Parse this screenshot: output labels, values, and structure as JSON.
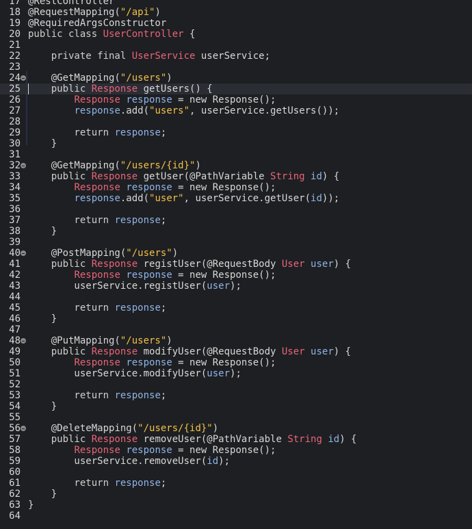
{
  "editor": {
    "language": "java",
    "current_line": 25,
    "colors": {
      "background": "#1e1f22",
      "current_line": "#2a2d34",
      "keyword": "#cfcfcf",
      "class": "#e8657a",
      "string": "#f0c14b",
      "variable": "#8fb4ea",
      "plain": "#d8d8d8",
      "fold_icon": "#8a8a8a"
    },
    "lines": [
      {
        "num": "17",
        "fold": false,
        "tokens": [
          {
            "t": "@RestController",
            "c": "ann"
          }
        ]
      },
      {
        "num": "18",
        "fold": false,
        "tokens": [
          {
            "t": "@RequestMapping(",
            "c": "ann"
          },
          {
            "t": "\"/api\"",
            "c": "str"
          },
          {
            "t": ")",
            "c": "plain"
          }
        ]
      },
      {
        "num": "19",
        "fold": false,
        "tokens": [
          {
            "t": "@RequiredArgsConstructor",
            "c": "ann"
          }
        ]
      },
      {
        "num": "20",
        "fold": false,
        "tokens": [
          {
            "t": "public class ",
            "c": "kw"
          },
          {
            "t": "UserController",
            "c": "cls"
          },
          {
            "t": " {",
            "c": "plain"
          }
        ]
      },
      {
        "num": "21",
        "fold": false,
        "tokens": []
      },
      {
        "num": "22",
        "fold": false,
        "tokens": [
          {
            "t": "    private final ",
            "c": "kw"
          },
          {
            "t": "UserService",
            "c": "cls"
          },
          {
            "t": " userService;",
            "c": "plain"
          }
        ]
      },
      {
        "num": "23",
        "fold": false,
        "tokens": []
      },
      {
        "num": "24",
        "fold": true,
        "tokens": [
          {
            "t": "    @GetMapping(",
            "c": "ann"
          },
          {
            "t": "\"/users\"",
            "c": "str"
          },
          {
            "t": ")",
            "c": "plain"
          }
        ]
      },
      {
        "num": "25",
        "fold": false,
        "tokens": [
          {
            "t": "    public ",
            "c": "kw"
          },
          {
            "t": "Response",
            "c": "cls"
          },
          {
            "t": " getUsers() {",
            "c": "plain"
          }
        ]
      },
      {
        "num": "26",
        "fold": false,
        "tokens": [
          {
            "t": "        ",
            "c": "plain"
          },
          {
            "t": "Response",
            "c": "cls"
          },
          {
            "t": " ",
            "c": "plain"
          },
          {
            "t": "response",
            "c": "var"
          },
          {
            "t": " = new Response();",
            "c": "plain"
          }
        ]
      },
      {
        "num": "27",
        "fold": false,
        "tokens": [
          {
            "t": "        ",
            "c": "plain"
          },
          {
            "t": "response",
            "c": "var"
          },
          {
            "t": ".add(",
            "c": "plain"
          },
          {
            "t": "\"users\"",
            "c": "str"
          },
          {
            "t": ", userService.getUsers());",
            "c": "plain"
          }
        ]
      },
      {
        "num": "28",
        "fold": false,
        "tokens": []
      },
      {
        "num": "29",
        "fold": false,
        "tokens": [
          {
            "t": "        return ",
            "c": "kw"
          },
          {
            "t": "response",
            "c": "var"
          },
          {
            "t": ";",
            "c": "plain"
          }
        ]
      },
      {
        "num": "30",
        "fold": false,
        "tokens": [
          {
            "t": "    }",
            "c": "plain"
          }
        ]
      },
      {
        "num": "31",
        "fold": false,
        "tokens": []
      },
      {
        "num": "32",
        "fold": true,
        "tokens": [
          {
            "t": "    @GetMapping(",
            "c": "ann"
          },
          {
            "t": "\"/users/{id}\"",
            "c": "str"
          },
          {
            "t": ")",
            "c": "plain"
          }
        ]
      },
      {
        "num": "33",
        "fold": false,
        "tokens": [
          {
            "t": "    public ",
            "c": "kw"
          },
          {
            "t": "Response",
            "c": "cls"
          },
          {
            "t": " getUser(@PathVariable ",
            "c": "plain"
          },
          {
            "t": "String",
            "c": "cls"
          },
          {
            "t": " ",
            "c": "plain"
          },
          {
            "t": "id",
            "c": "var"
          },
          {
            "t": ") {",
            "c": "plain"
          }
        ]
      },
      {
        "num": "34",
        "fold": false,
        "tokens": [
          {
            "t": "        ",
            "c": "plain"
          },
          {
            "t": "Response",
            "c": "cls"
          },
          {
            "t": " ",
            "c": "plain"
          },
          {
            "t": "response",
            "c": "var"
          },
          {
            "t": " = new Response();",
            "c": "plain"
          }
        ]
      },
      {
        "num": "35",
        "fold": false,
        "tokens": [
          {
            "t": "        ",
            "c": "plain"
          },
          {
            "t": "response",
            "c": "var"
          },
          {
            "t": ".add(",
            "c": "plain"
          },
          {
            "t": "\"user\"",
            "c": "str"
          },
          {
            "t": ", userService.getUser(",
            "c": "plain"
          },
          {
            "t": "id",
            "c": "var"
          },
          {
            "t": "));",
            "c": "plain"
          }
        ]
      },
      {
        "num": "36",
        "fold": false,
        "tokens": []
      },
      {
        "num": "37",
        "fold": false,
        "tokens": [
          {
            "t": "        return ",
            "c": "kw"
          },
          {
            "t": "response",
            "c": "var"
          },
          {
            "t": ";",
            "c": "plain"
          }
        ]
      },
      {
        "num": "38",
        "fold": false,
        "tokens": [
          {
            "t": "    }",
            "c": "plain"
          }
        ]
      },
      {
        "num": "39",
        "fold": false,
        "tokens": []
      },
      {
        "num": "40",
        "fold": true,
        "tokens": [
          {
            "t": "    @PostMapping(",
            "c": "ann"
          },
          {
            "t": "\"/users\"",
            "c": "str"
          },
          {
            "t": ")",
            "c": "plain"
          }
        ]
      },
      {
        "num": "41",
        "fold": false,
        "tokens": [
          {
            "t": "    public ",
            "c": "kw"
          },
          {
            "t": "Response",
            "c": "cls"
          },
          {
            "t": " registUser(@RequestBody ",
            "c": "plain"
          },
          {
            "t": "User",
            "c": "cls"
          },
          {
            "t": " ",
            "c": "plain"
          },
          {
            "t": "user",
            "c": "var"
          },
          {
            "t": ") {",
            "c": "plain"
          }
        ]
      },
      {
        "num": "42",
        "fold": false,
        "tokens": [
          {
            "t": "        ",
            "c": "plain"
          },
          {
            "t": "Response",
            "c": "cls"
          },
          {
            "t": " ",
            "c": "plain"
          },
          {
            "t": "response",
            "c": "var"
          },
          {
            "t": " = new Response();",
            "c": "plain"
          }
        ]
      },
      {
        "num": "43",
        "fold": false,
        "tokens": [
          {
            "t": "        userService.registUser(",
            "c": "plain"
          },
          {
            "t": "user",
            "c": "var"
          },
          {
            "t": ");",
            "c": "plain"
          }
        ]
      },
      {
        "num": "44",
        "fold": false,
        "tokens": []
      },
      {
        "num": "45",
        "fold": false,
        "tokens": [
          {
            "t": "        return ",
            "c": "kw"
          },
          {
            "t": "response",
            "c": "var"
          },
          {
            "t": ";",
            "c": "plain"
          }
        ]
      },
      {
        "num": "46",
        "fold": false,
        "tokens": [
          {
            "t": "    }",
            "c": "plain"
          }
        ]
      },
      {
        "num": "47",
        "fold": false,
        "tokens": []
      },
      {
        "num": "48",
        "fold": true,
        "tokens": [
          {
            "t": "    @PutMapping(",
            "c": "ann"
          },
          {
            "t": "\"/users\"",
            "c": "str"
          },
          {
            "t": ")",
            "c": "plain"
          }
        ]
      },
      {
        "num": "49",
        "fold": false,
        "tokens": [
          {
            "t": "    public ",
            "c": "kw"
          },
          {
            "t": "Response",
            "c": "cls"
          },
          {
            "t": " modifyUser(@RequestBody ",
            "c": "plain"
          },
          {
            "t": "User",
            "c": "cls"
          },
          {
            "t": " ",
            "c": "plain"
          },
          {
            "t": "user",
            "c": "var"
          },
          {
            "t": ") {",
            "c": "plain"
          }
        ]
      },
      {
        "num": "50",
        "fold": false,
        "tokens": [
          {
            "t": "        ",
            "c": "plain"
          },
          {
            "t": "Response",
            "c": "cls"
          },
          {
            "t": " ",
            "c": "plain"
          },
          {
            "t": "response",
            "c": "var"
          },
          {
            "t": " = new Response();",
            "c": "plain"
          }
        ]
      },
      {
        "num": "51",
        "fold": false,
        "tokens": [
          {
            "t": "        userService.modifyUser(",
            "c": "plain"
          },
          {
            "t": "user",
            "c": "var"
          },
          {
            "t": ");",
            "c": "plain"
          }
        ]
      },
      {
        "num": "52",
        "fold": false,
        "tokens": []
      },
      {
        "num": "53",
        "fold": false,
        "tokens": [
          {
            "t": "        return ",
            "c": "kw"
          },
          {
            "t": "response",
            "c": "var"
          },
          {
            "t": ";",
            "c": "plain"
          }
        ]
      },
      {
        "num": "54",
        "fold": false,
        "tokens": [
          {
            "t": "    }",
            "c": "plain"
          }
        ]
      },
      {
        "num": "55",
        "fold": false,
        "tokens": []
      },
      {
        "num": "56",
        "fold": true,
        "tokens": [
          {
            "t": "    @DeleteMapping(",
            "c": "ann"
          },
          {
            "t": "\"/users/{id}\"",
            "c": "str"
          },
          {
            "t": ")",
            "c": "plain"
          }
        ]
      },
      {
        "num": "57",
        "fold": false,
        "tokens": [
          {
            "t": "    public ",
            "c": "kw"
          },
          {
            "t": "Response",
            "c": "cls"
          },
          {
            "t": " removeUser(@PathVariable ",
            "c": "plain"
          },
          {
            "t": "String",
            "c": "cls"
          },
          {
            "t": " ",
            "c": "plain"
          },
          {
            "t": "id",
            "c": "var"
          },
          {
            "t": ") {",
            "c": "plain"
          }
        ]
      },
      {
        "num": "58",
        "fold": false,
        "tokens": [
          {
            "t": "        ",
            "c": "plain"
          },
          {
            "t": "Response",
            "c": "cls"
          },
          {
            "t": " ",
            "c": "plain"
          },
          {
            "t": "response",
            "c": "var"
          },
          {
            "t": " = new Response();",
            "c": "plain"
          }
        ]
      },
      {
        "num": "59",
        "fold": false,
        "tokens": [
          {
            "t": "        userService.removeUser(",
            "c": "plain"
          },
          {
            "t": "id",
            "c": "var"
          },
          {
            "t": ");",
            "c": "plain"
          }
        ]
      },
      {
        "num": "60",
        "fold": false,
        "tokens": []
      },
      {
        "num": "61",
        "fold": false,
        "tokens": [
          {
            "t": "        return ",
            "c": "kw"
          },
          {
            "t": "response",
            "c": "var"
          },
          {
            "t": ";",
            "c": "plain"
          }
        ]
      },
      {
        "num": "62",
        "fold": false,
        "tokens": [
          {
            "t": "    }",
            "c": "plain"
          }
        ]
      },
      {
        "num": "63",
        "fold": false,
        "tokens": [
          {
            "t": "}",
            "c": "plain"
          }
        ]
      },
      {
        "num": "64",
        "fold": false,
        "tokens": []
      }
    ]
  }
}
